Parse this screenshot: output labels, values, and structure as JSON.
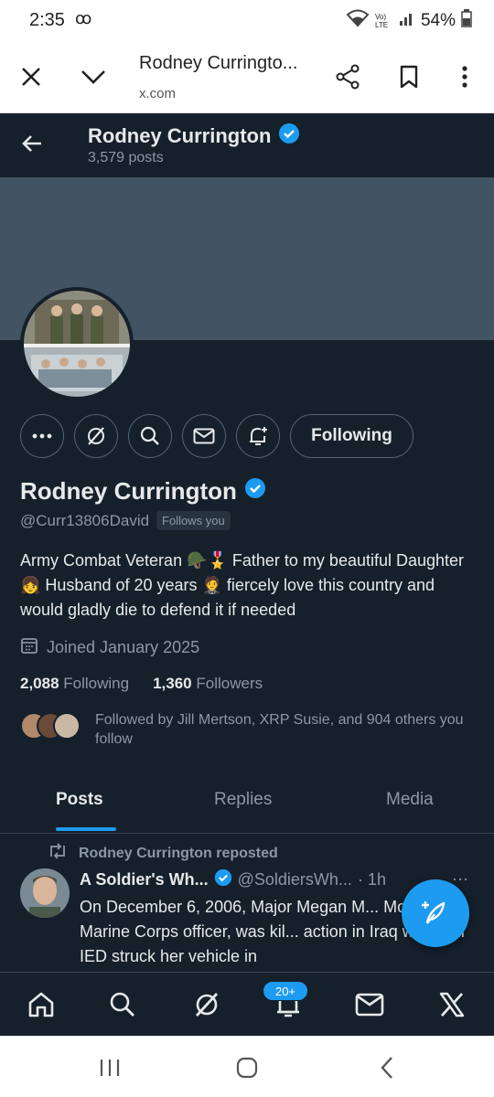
{
  "status_bar": {
    "time": "2:35",
    "time_extra": "ꝏ",
    "battery": "54%",
    "signal_label": "Vo) LTE"
  },
  "browser": {
    "title": "Rodney Curringto...",
    "url": "x.com"
  },
  "header": {
    "name": "Rodney Currington",
    "posts_count": "3,579 posts"
  },
  "profile": {
    "name": "Rodney Currington",
    "handle": "@Curr13806David",
    "follows_you": "Follows you",
    "following_button": "Following",
    "bio": "Army Combat Veteran 🪖🎖️ Father to my beautiful Daughter 👧 Husband of 20 years 🤵 fiercely love this country and would gladly die to defend it if needed",
    "joined": "Joined January 2025",
    "following_count": "2,088",
    "following_label": "Following",
    "followers_count": "1,360",
    "followers_label": "Followers",
    "followed_by": "Followed by Jill Mertson, XRP Susie, and 904 others you follow"
  },
  "tabs": [
    {
      "label": "Posts",
      "active": true
    },
    {
      "label": "Replies",
      "active": false
    },
    {
      "label": "Media",
      "active": false
    }
  ],
  "post": {
    "repost_label": "Rodney Currington reposted",
    "author": "A Soldier's Wh...",
    "handle": "@SoldiersWh...",
    "time": "· 1h",
    "more": "···",
    "text": "On December 6, 2006, Major Megan M... McClung, a Marine Corps officer, was kil... action in Iraq when an IED struck her vehicle in"
  },
  "bottom_nav": {
    "notif_badge": "20+"
  },
  "colors": {
    "background": "#15202b",
    "accent": "#1d9bf0",
    "banner": "#425363",
    "text_primary": "#e7e9ea",
    "text_secondary": "#8b98a5"
  }
}
